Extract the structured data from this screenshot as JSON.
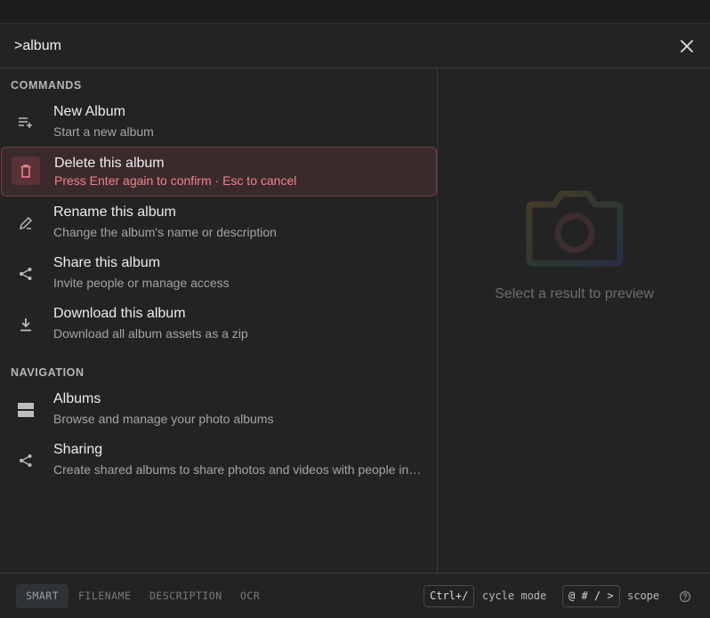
{
  "search": {
    "value": ">album",
    "placeholder": ""
  },
  "sections": {
    "commands": "COMMANDS",
    "navigation": "NAVIGATION"
  },
  "commands": [
    {
      "title": "New Album",
      "subtitle": "Start a new album",
      "icon": "playlist-add-icon"
    },
    {
      "title": "Delete this album",
      "subtitle": "Press Enter again to confirm · Esc to cancel",
      "icon": "trash-icon"
    },
    {
      "title": "Rename this album",
      "subtitle": "Change the album's name or description",
      "icon": "pencil-icon"
    },
    {
      "title": "Share this album",
      "subtitle": "Invite people or manage access",
      "icon": "share-icon"
    },
    {
      "title": "Download this album",
      "subtitle": "Download all album assets as a zip",
      "icon": "download-icon"
    }
  ],
  "navigation": [
    {
      "title": "Albums",
      "subtitle": "Browse and manage your photo albums",
      "icon": "albums-icon"
    },
    {
      "title": "Sharing",
      "subtitle": "Create shared albums to share photos and videos with people in your network",
      "icon": "share-icon"
    }
  ],
  "preview": {
    "text": "Select a result to preview",
    "icon": "camera-icon"
  },
  "footer": {
    "modes": [
      "SMART",
      "FILENAME",
      "DESCRIPTION",
      "OCR"
    ],
    "active_mode": "SMART",
    "cycle_key": "Ctrl+/",
    "cycle_label": "cycle mode",
    "scope_keys": "@ # / >",
    "scope_label": "scope"
  },
  "colors": {
    "background": "#232323",
    "danger_bg": "#3b2a2c",
    "danger_text": "#f0838d",
    "danger_border": "#6e4348"
  }
}
